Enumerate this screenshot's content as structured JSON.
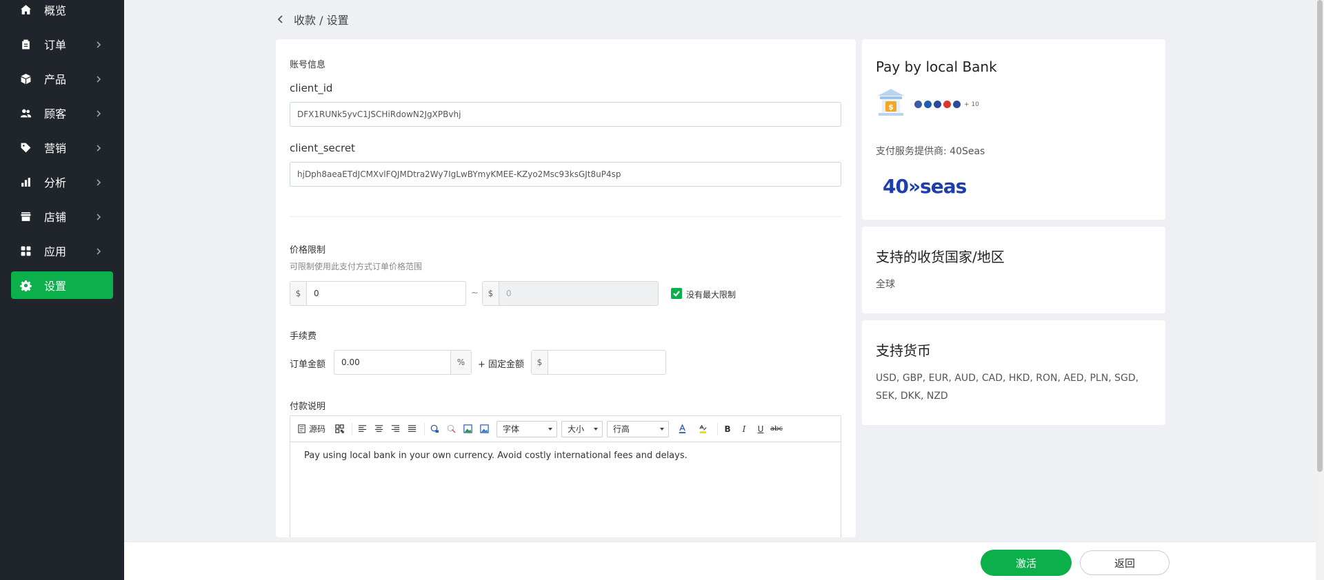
{
  "sidebar": {
    "items": [
      {
        "label": "概览",
        "icon": "home-icon",
        "active": false
      },
      {
        "label": "订单",
        "icon": "clipboard-icon",
        "active": false
      },
      {
        "label": "产品",
        "icon": "box-icon",
        "active": false
      },
      {
        "label": "顾客",
        "icon": "users-icon",
        "active": false
      },
      {
        "label": "营销",
        "icon": "tag-icon",
        "active": false
      },
      {
        "label": "分析",
        "icon": "bar-chart-icon",
        "active": false
      },
      {
        "label": "店铺",
        "icon": "store-icon",
        "active": false
      },
      {
        "label": "应用",
        "icon": "apps-icon",
        "active": false
      },
      {
        "label": "设置",
        "icon": "gear-icon",
        "active": true
      }
    ],
    "active_color": "#0cb04a",
    "background": "#20252c"
  },
  "breadcrumb": {
    "text": "收款 / 设置"
  },
  "account": {
    "section_label": "账号信息",
    "client_id_label": "client_id",
    "client_id_value": "DFX1RUNk5yvC1JSCHiRdowN2JgXPBvhj",
    "client_secret_label": "client_secret",
    "client_secret_value": "hjDph8aeaETdJCMXvlFQJMDtra2Wy7IgLwBYmyKMEE-KZyo2Msc93ksGJt8uP4sp"
  },
  "price_limit": {
    "label": "价格限制",
    "hint": "可限制使用此支付方式订单价格范围",
    "currency_prefix": "$",
    "min_value": "0",
    "max_placeholder": "0",
    "separator": "~",
    "no_max_label": "没有最大限制",
    "no_max_checked": true
  },
  "fee": {
    "label": "手续费",
    "order_amount_label": "订单金额",
    "percent_value": "0.00",
    "percent_suffix": "%",
    "plus_fixed_label": "+ 固定金额",
    "fixed_prefix": "$",
    "fixed_value": ""
  },
  "description": {
    "label": "付款说明",
    "toolbar": {
      "source_label": "源码",
      "font_label": "字体",
      "size_label": "大小",
      "line_height_label": "行高",
      "strike_label": "abc"
    },
    "content": "Pay using local bank in your own currency. Avoid costly international fees and delays."
  },
  "payment_panel": {
    "title": "Pay by local Bank",
    "flags": [
      "#3c5aa6",
      "#1f5fb0",
      "#2a4b9b",
      "#d9352c",
      "#2a4b9b"
    ],
    "more_count": "+ 10",
    "provider_text": "支付服务提供商: 40Seas",
    "provider_logo": "40»seas"
  },
  "regions_panel": {
    "title": "支持的收货国家/地区",
    "value": "全球"
  },
  "currency_panel": {
    "title": "支持货币",
    "value": "USD, GBP, EUR, AUD, CAD, HKD, RON, AED, PLN, SGD, SEK, DKK, NZD"
  },
  "actions": {
    "activate_label": "激活",
    "back_label": "返回"
  }
}
